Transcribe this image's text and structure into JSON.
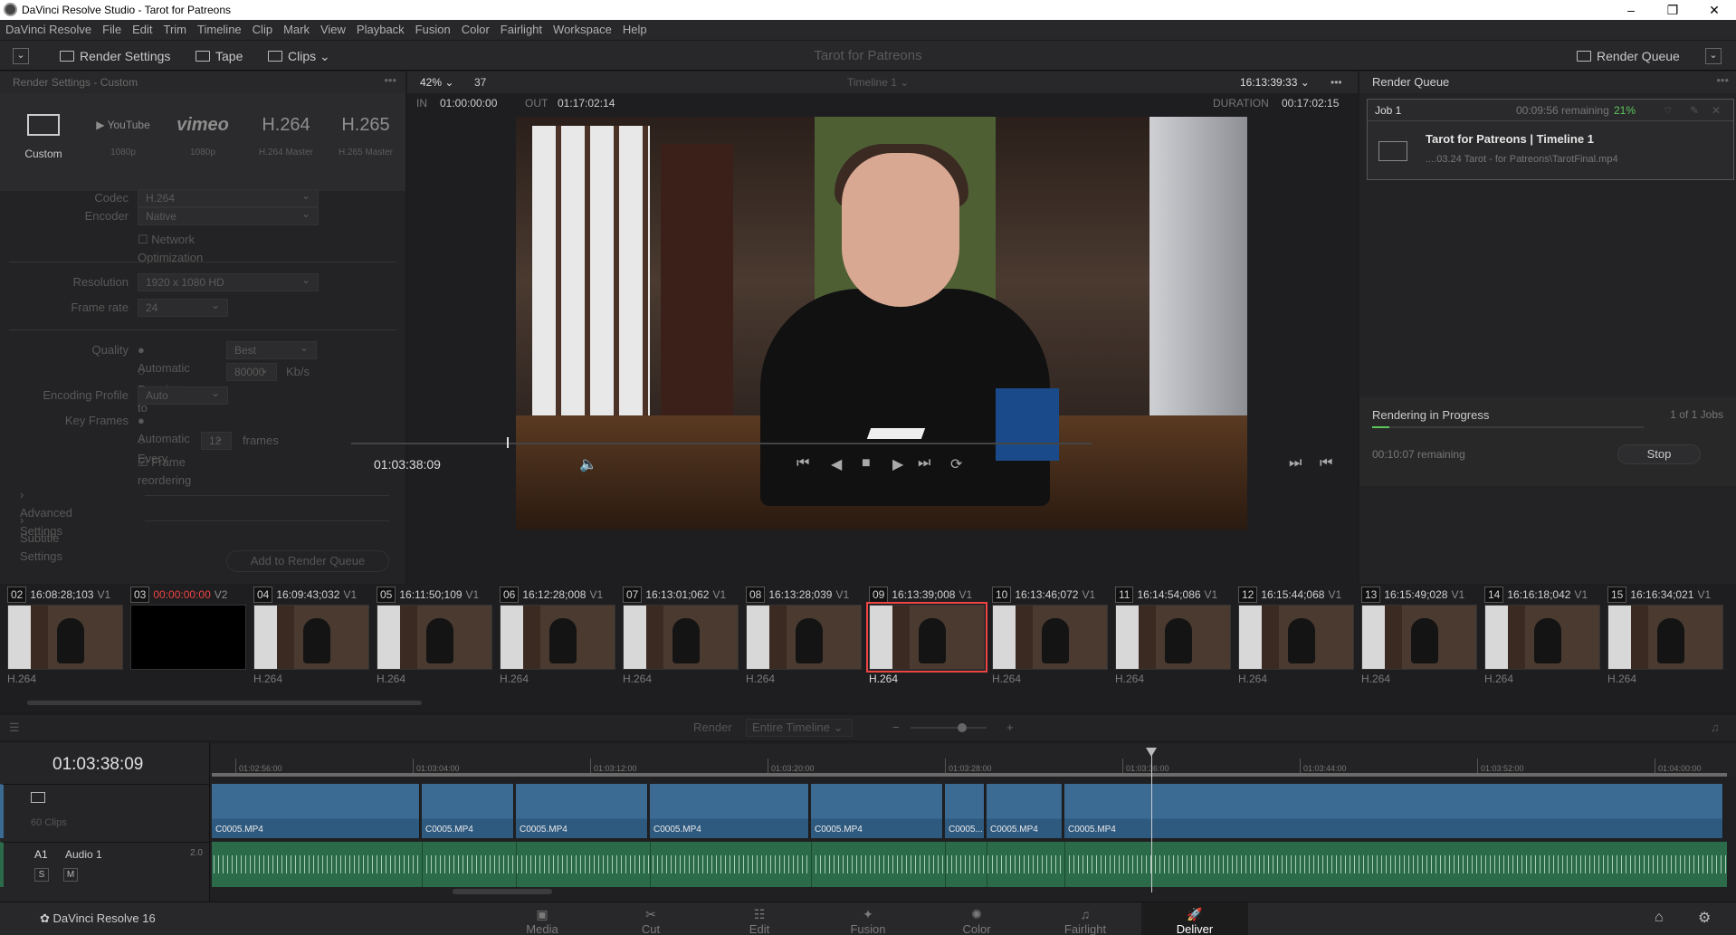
{
  "window": {
    "title": "DaVinci Resolve Studio - Tarot for Patreons"
  },
  "menu": [
    "DaVinci Resolve",
    "File",
    "Edit",
    "Trim",
    "Timeline",
    "Clip",
    "Mark",
    "View",
    "Playback",
    "Fusion",
    "Color",
    "Fairlight",
    "Workspace",
    "Help"
  ],
  "toolbar": {
    "render_settings": "Render Settings",
    "tape": "Tape",
    "clips": "Clips",
    "project_title": "Tarot for Patreons",
    "render_queue": "Render Queue"
  },
  "render_settings": {
    "header": "Render Settings - Custom",
    "presets": [
      {
        "big": "",
        "sub": "Custom"
      },
      {
        "big": "▶ YouTube",
        "sub": "1080p"
      },
      {
        "big": "vimeo",
        "sub": "1080p"
      },
      {
        "big": "H.264",
        "sub": "H.264 Master"
      },
      {
        "big": "H.265",
        "sub": "H.265 Master"
      }
    ],
    "codec_label": "Codec",
    "codec": "H.264",
    "encoder_label": "Encoder",
    "encoder": "Native",
    "network_opt": "Network Optimization",
    "resolution_label": "Resolution",
    "resolution": "1920 x 1080 HD",
    "framerate_label": "Frame rate",
    "framerate": "24",
    "quality_label": "Quality",
    "quality_auto": "Automatic",
    "quality_best": "Best",
    "restrict_to": "Restrict to",
    "restrict_value": "80000",
    "restrict_unit": "Kb/s",
    "encoding_profile_label": "Encoding Profile",
    "encoding_profile": "Auto",
    "keyframes_label": "Key Frames",
    "kf_auto": "Automatic",
    "kf_every": "Every",
    "kf_value": "12",
    "kf_unit": "frames",
    "frame_reordering": "Frame reordering",
    "advanced": "Advanced Settings",
    "subtitle": "Subtitle Settings",
    "add_to_queue": "Add to Render Queue"
  },
  "viewer": {
    "zoom": "42%",
    "zoom_num": "37",
    "timeline": "Timeline 1",
    "timecode_top": "16:13:39:33",
    "in_label": "IN",
    "in": "01:00:00:00",
    "out_label": "OUT",
    "out": "01:17:02:14",
    "duration_label": "DURATION",
    "duration": "00:17:02:15",
    "timecode": "01:03:38:09"
  },
  "render_queue": {
    "header": "Render Queue",
    "job": "Job 1",
    "remaining": "00:09:56 remaining",
    "percent": "21%",
    "job_title": "Tarot for Patreons | Timeline 1",
    "job_path": "....03.24 Tarot - for Patreons\\TarotFinal.mp4",
    "progress_label": "Rendering in Progress",
    "jobs_count": "1 of 1 Jobs",
    "progress_remaining": "00:10:07 remaining",
    "stop": "Stop"
  },
  "clips": [
    {
      "n": "02",
      "tc": "16:08:28;103",
      "v": "V1",
      "codec": "H.264"
    },
    {
      "n": "03",
      "tc": "00:00:00:00",
      "v": "V2",
      "codec": "",
      "black": true
    },
    {
      "n": "04",
      "tc": "16:09:43;032",
      "v": "V1",
      "codec": "H.264"
    },
    {
      "n": "05",
      "tc": "16:11:50;109",
      "v": "V1",
      "codec": "H.264"
    },
    {
      "n": "06",
      "tc": "16:12:28;008",
      "v": "V1",
      "codec": "H.264"
    },
    {
      "n": "07",
      "tc": "16:13:01;062",
      "v": "V1",
      "codec": "H.264"
    },
    {
      "n": "08",
      "tc": "16:13:28;039",
      "v": "V1",
      "codec": "H.264"
    },
    {
      "n": "09",
      "tc": "16:13:39;008",
      "v": "V1",
      "codec": "H.264",
      "selected": true
    },
    {
      "n": "10",
      "tc": "16:13:46;072",
      "v": "V1",
      "codec": "H.264"
    },
    {
      "n": "11",
      "tc": "16:14:54;086",
      "v": "V1",
      "codec": "H.264"
    },
    {
      "n": "12",
      "tc": "16:15:44;068",
      "v": "V1",
      "codec": "H.264"
    },
    {
      "n": "13",
      "tc": "16:15:49;028",
      "v": "V1",
      "codec": "H.264"
    },
    {
      "n": "14",
      "tc": "16:16:18;042",
      "v": "V1",
      "codec": "H.264"
    },
    {
      "n": "15",
      "tc": "16:16:34;021",
      "v": "V1",
      "codec": "H.264"
    }
  ],
  "timeline_bar": {
    "render": "Render",
    "range": "Entire Timeline"
  },
  "timeline": {
    "timecode": "01:03:38:09",
    "clips_count": "60 Clips",
    "audio_track": "A1",
    "audio_name": "Audio 1",
    "audio_level": "2.0",
    "solo": "S",
    "mute": "M",
    "ruler": [
      "01:02:56:00",
      "01:03:04:00",
      "01:03:12:00",
      "01:03:20:00",
      "01:03:28:00",
      "01:03:36:00",
      "01:03:44:00",
      "01:03:52:00",
      "01:04:00:00"
    ],
    "video_clips": [
      "C0005.MP4",
      "C0005.MP4",
      "C0005.MP4",
      "C0005.MP4",
      "C0005.MP4",
      "C0005...",
      "C0005.MP4",
      "C0005.MP4"
    ]
  },
  "pages": {
    "brand": "DaVinci Resolve 16",
    "items": [
      "Media",
      "Cut",
      "Edit",
      "Fusion",
      "Color",
      "Fairlight",
      "Deliver"
    ]
  }
}
